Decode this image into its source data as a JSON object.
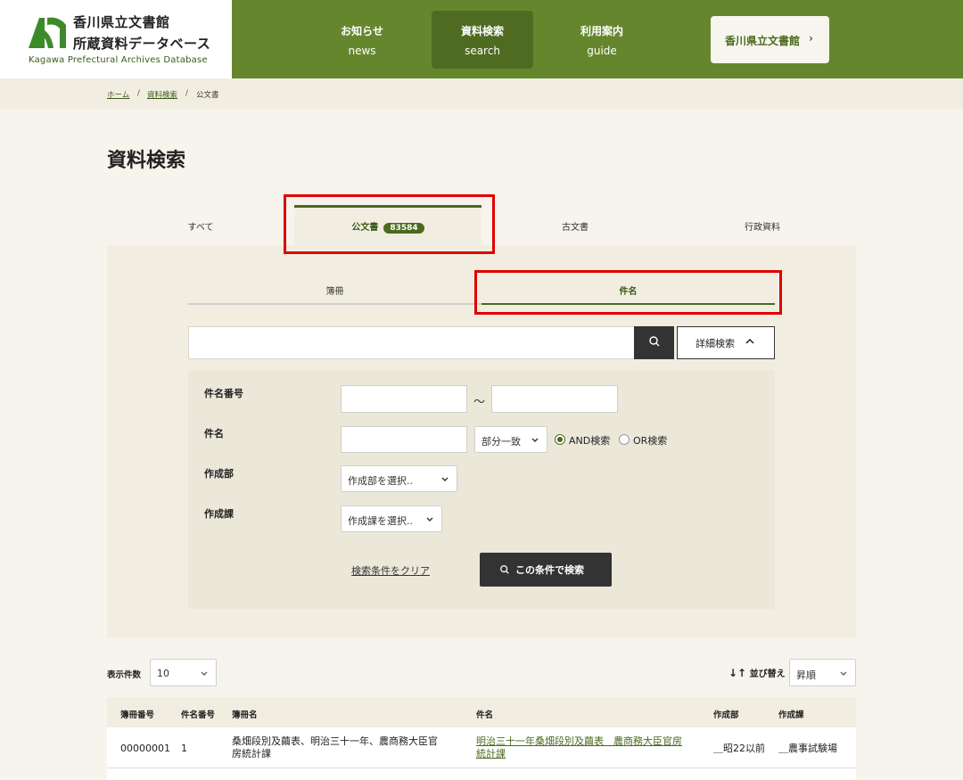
{
  "header": {
    "logo_title_line1": "香川県立文書館",
    "logo_title_line2": "所蔵資料データベース",
    "logo_subtitle": "Kagawa Prefectural Archives Database",
    "nav": [
      {
        "jp": "お知らせ",
        "en": "news"
      },
      {
        "jp": "資料検索",
        "en": "search"
      },
      {
        "jp": "利用案内",
        "en": "guide"
      }
    ],
    "external_button": "香川県立文書館",
    "external_chevron": "›",
    "accent_color": "#66862e"
  },
  "breadcrumb": {
    "home": "ホーム",
    "search": "資料検索",
    "current": "公文書",
    "separator": "/"
  },
  "page_title": "資料検索",
  "tabs": [
    {
      "label": "すべて"
    },
    {
      "label": "公文書",
      "count": "83584"
    },
    {
      "label": "古文書"
    },
    {
      "label": "行政資料"
    }
  ],
  "sub_tabs": [
    {
      "label": "簿冊"
    },
    {
      "label": "件名"
    }
  ],
  "search": {
    "query": "",
    "detail_button": "詳細検索",
    "caret": "^"
  },
  "detail": {
    "item_number_label": "件名番号",
    "tilde": "～",
    "item_name_label": "件名",
    "match_select": "部分一致",
    "and_label": "AND検索",
    "or_label": "OR検索",
    "dept_label": "作成部",
    "dept_placeholder": "作成部を選択..",
    "section_label": "作成課",
    "section_placeholder": "作成課を選択..",
    "clear_link": "検索条件をクリア",
    "submit_button": "この条件で検索"
  },
  "results": {
    "display_count_label": "表示件数",
    "display_count_value": "10",
    "sort_icon": "↓↑",
    "sort_label": "並び替え",
    "sort_value": "昇順",
    "columns": [
      "簿冊番号",
      "件名番号",
      "簿冊名",
      "件名",
      "作成部",
      "作成課"
    ],
    "rows": [
      {
        "book_no": "00000001",
        "item_no": "1",
        "book_name_1": "桑畑段別及繭表、明治三十一年、農商務大臣官",
        "book_name_2": "房統計課",
        "item_name_1": "明治三十一年桑畑段別及繭表　農商務大臣官房",
        "item_name_2": "統計課",
        "dept": "＿昭22以前",
        "section": "＿農事試験場"
      }
    ]
  }
}
